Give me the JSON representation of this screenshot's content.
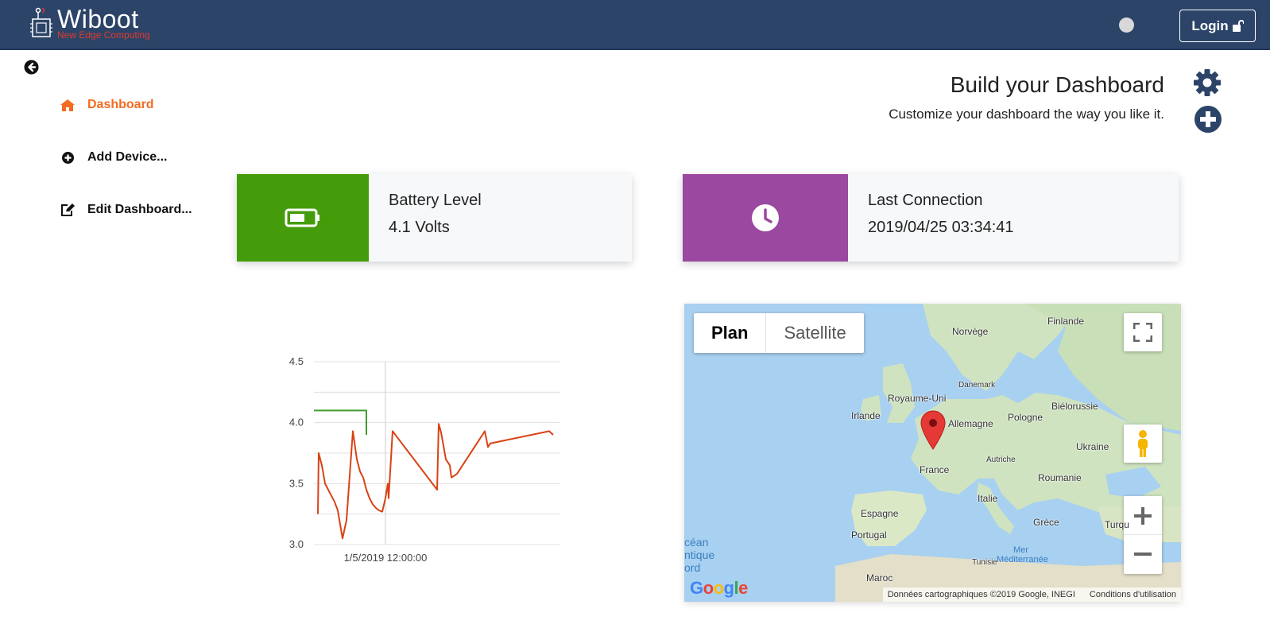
{
  "app": {
    "name": "Wiboot",
    "tagline": "New Edge Computing",
    "login_label": "Login"
  },
  "sidebar": {
    "items": [
      {
        "label": "Dashboard",
        "icon": "home-icon",
        "active": true
      },
      {
        "label": "Add Device...",
        "icon": "plus-circle-icon",
        "active": false
      },
      {
        "label": "Edit Dashboard...",
        "icon": "edit-icon",
        "active": false
      }
    ]
  },
  "header": {
    "title": "Build your Dashboard",
    "subtitle": "Customize your dashboard the way you like it."
  },
  "cards": [
    {
      "title": "Battery Level",
      "value": "4.1 Volts",
      "icon": "battery-icon",
      "color": "#449c0a"
    },
    {
      "title": "Last Connection",
      "value": "2019/04/25 03:34:41",
      "icon": "clock-icon",
      "color": "#9a48a0"
    }
  ],
  "chart_data": {
    "type": "line",
    "title": "",
    "xlabel": "",
    "ylabel": "",
    "ylim": [
      3.0,
      4.5
    ],
    "yticks": [
      "4.5",
      "4.0",
      "3.5",
      "3.0"
    ],
    "xtick_label": "1/5/2019 12:00:00",
    "grid": true,
    "series": [
      {
        "color": "#3e9b2e",
        "points": [
          [
            0,
            4.1
          ],
          [
            66,
            4.1
          ],
          [
            66,
            3.9
          ]
        ]
      },
      {
        "color": "#d84315",
        "points": [
          [
            5,
            3.25
          ],
          [
            6,
            3.75
          ],
          [
            10,
            3.65
          ],
          [
            14,
            3.5
          ],
          [
            18,
            3.45
          ],
          [
            22,
            3.4
          ],
          [
            26,
            3.35
          ],
          [
            30,
            3.28
          ],
          [
            36,
            3.05
          ],
          [
            41,
            3.2
          ],
          [
            49,
            3.93
          ],
          [
            54,
            3.7
          ],
          [
            58,
            3.6
          ],
          [
            62,
            3.55
          ],
          [
            66,
            3.45
          ],
          [
            70,
            3.38
          ],
          [
            74,
            3.33
          ],
          [
            78,
            3.3
          ],
          [
            82,
            3.28
          ],
          [
            86,
            3.27
          ],
          [
            90,
            3.38
          ],
          [
            93,
            3.5
          ],
          [
            94,
            3.38
          ],
          [
            99,
            3.93
          ],
          [
            155,
            3.45
          ],
          [
            157,
            3.99
          ],
          [
            160,
            3.92
          ],
          [
            166,
            3.7
          ],
          [
            171,
            3.65
          ],
          [
            173,
            3.55
          ],
          [
            180,
            3.58
          ],
          [
            215,
            3.93
          ],
          [
            219,
            3.8
          ],
          [
            222,
            3.83
          ],
          [
            296,
            3.93
          ],
          [
            301,
            3.9
          ]
        ]
      }
    ]
  },
  "map": {
    "type_buttons": [
      "Plan",
      "Satellite"
    ],
    "selected_type": "Plan",
    "labels": [
      "Finlande",
      "Norvège",
      "Danemark",
      "Royaume-Uni",
      "Irlande",
      "Biélorussie",
      "Pologne",
      "Allemagne",
      "Ukraine",
      "Autriche",
      "France",
      "Roumanie",
      "Italie",
      "Espagne",
      "Portugal",
      "Grèce",
      "Turqu",
      "Tunisie",
      "Mer",
      "Méditerranée",
      "Maroc"
    ],
    "ocean_label": [
      "céan",
      "ntique",
      "ord"
    ],
    "attribution": "Données cartographiques ©2019 Google, INEGI",
    "terms": "Conditions d'utilisation",
    "google_logo": "Google"
  }
}
